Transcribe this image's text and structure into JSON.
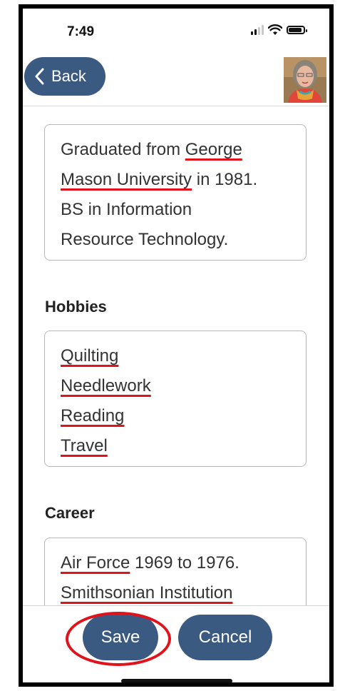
{
  "status_bar": {
    "time": "7:49"
  },
  "nav": {
    "back_label": "Back"
  },
  "education": {
    "lines": [
      [
        {
          "text": "Graduated from ",
          "u": false
        },
        {
          "text": "George",
          "u": true
        }
      ],
      [
        {
          "text": "Mason University",
          "u": true
        },
        {
          "text": " in 1981.",
          "u": false
        }
      ],
      [
        {
          "text": " BS in Information",
          "u": false
        }
      ],
      [
        {
          "text": "Resource Technology.",
          "u": false
        }
      ]
    ]
  },
  "hobbies": {
    "label": "Hobbies",
    "items": [
      "Quilting",
      "Needlework",
      "Reading",
      "Travel"
    ]
  },
  "career": {
    "label": "Career",
    "lines": [
      [
        {
          "text": "Air Force",
          "u": true
        },
        {
          "text": " 1969 to 1976.",
          "u": false
        }
      ],
      [
        {
          "text": "Smithsonian Institution",
          "u": true
        }
      ]
    ]
  },
  "actions": {
    "save_label": "Save",
    "cancel_label": "Cancel"
  },
  "colors": {
    "button": "#3b5a82",
    "annotation_red": "#e0121b"
  }
}
